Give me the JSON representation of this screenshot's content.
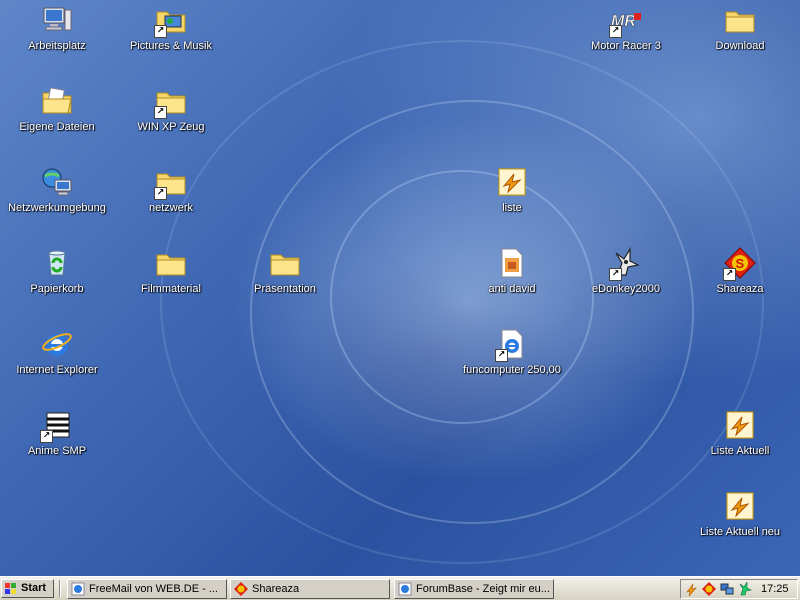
{
  "desktop": {
    "icons": [
      {
        "label": "Arbeitsplatz",
        "icon": "computer-icon"
      },
      {
        "label": "Pictures & Musik",
        "icon": "folder-media-icon"
      },
      {
        "label": "Motor Racer 3",
        "icon": "motor-racer-icon"
      },
      {
        "label": "Download",
        "icon": "folder-icon"
      },
      {
        "label": "Eigene Dateien",
        "icon": "my-documents-icon"
      },
      {
        "label": "WIN XP Zeug",
        "icon": "folder-icon"
      },
      {
        "label": "Netzwerkumgebung",
        "icon": "network-icon"
      },
      {
        "label": "netzwerk",
        "icon": "folder-icon"
      },
      {
        "label": "liste",
        "icon": "winamp-icon"
      },
      {
        "label": "Papierkorb",
        "icon": "recycle-bin-icon"
      },
      {
        "label": "Filmmaterial",
        "icon": "folder-icon"
      },
      {
        "label": "Präsentation",
        "icon": "folder-icon"
      },
      {
        "label": "anti david",
        "icon": "image-file-icon"
      },
      {
        "label": "eDonkey2000",
        "icon": "edonkey-icon"
      },
      {
        "label": "Shareaza",
        "icon": "shareaza-icon"
      },
      {
        "label": "Internet Explorer",
        "icon": "internet-explorer-icon"
      },
      {
        "label": "funcomputer 250,00",
        "icon": "internet-shortcut-icon"
      },
      {
        "label": "Anime SMP",
        "icon": "anime-smp-icon"
      },
      {
        "label": "Liste Aktuell",
        "icon": "winamp-icon"
      },
      {
        "label": "Liste Aktuell neu",
        "icon": "winamp-icon"
      }
    ]
  },
  "taskbar": {
    "start_label": "Start",
    "tasks": [
      {
        "label": "FreeMail von WEB.DE - ...",
        "icon": "ie-page-icon"
      },
      {
        "label": "Shareaza",
        "icon": "shareaza-icon"
      },
      {
        "label": "ForumBase - Zeigt mir eu...",
        "icon": "ie-page-icon"
      }
    ],
    "tray_icons": [
      "winamp-icon",
      "shareaza-icon",
      "network-icon",
      "edonkey-icon"
    ],
    "clock": "17:25"
  },
  "colors": {
    "taskbar": "#d4d0c8",
    "desktop": "#3f68b4"
  }
}
